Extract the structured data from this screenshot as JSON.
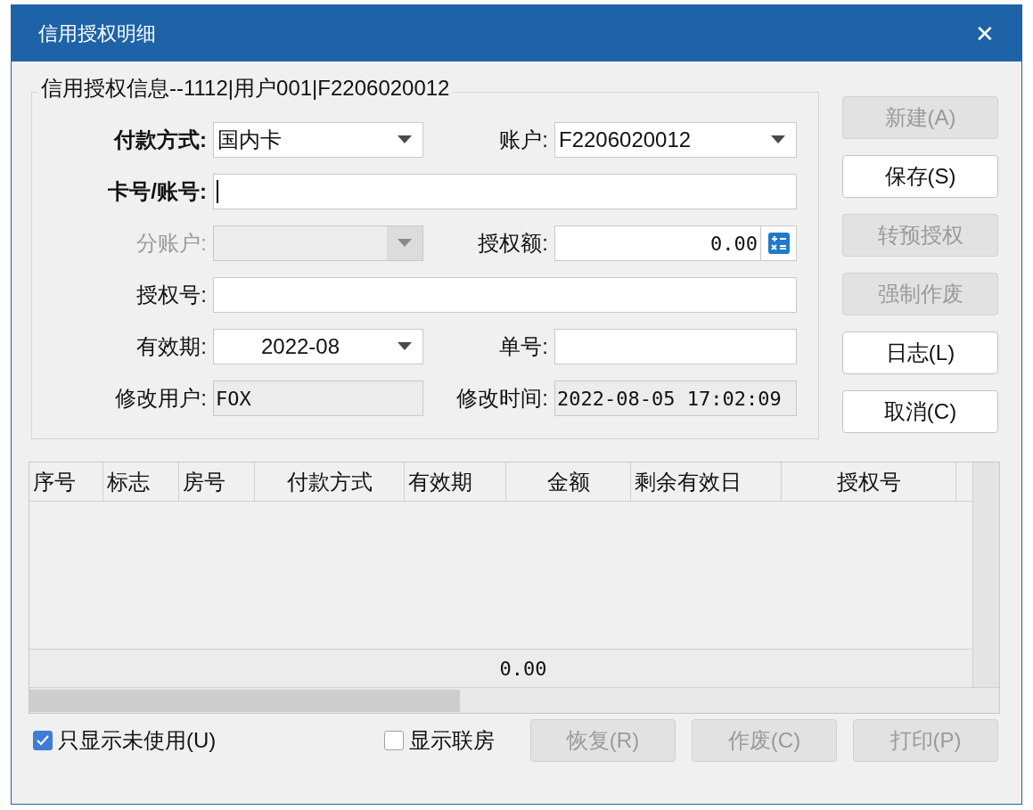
{
  "window": {
    "title": "信用授权明细",
    "close": "✕"
  },
  "group": {
    "title": "信用授权信息--1112|用户001|F2206020012"
  },
  "form_rows": [
    {
      "fields": [
        {
          "kind": "select",
          "label": "付款方式:",
          "bold": true,
          "value": "国内卡",
          "disabled": false
        },
        {
          "kind": "select",
          "label": "账户:",
          "bold": false,
          "value": "F2206020012",
          "disabled": false
        }
      ]
    },
    {
      "fields": [
        {
          "kind": "text",
          "label": "卡号/账号:",
          "bold": true,
          "focused": true
        }
      ]
    },
    {
      "fields": [
        {
          "kind": "select",
          "label": "分账户:",
          "bold": false,
          "disabled": true
        },
        {
          "kind": "number",
          "label": "授权额:",
          "bold": false,
          "value": "0.00"
        }
      ]
    },
    {
      "fields": [
        {
          "kind": "text",
          "label": "授权号:",
          "bold": false,
          "focused": false
        }
      ]
    },
    {
      "fields": [
        {
          "kind": "select",
          "label": "有效期:",
          "bold": false,
          "value": "2022-08",
          "centered": true,
          "disabled": false
        },
        {
          "kind": "text",
          "label": "单号:",
          "bold": false,
          "focused": false
        }
      ]
    },
    {
      "fields": [
        {
          "kind": "readonly",
          "label": "修改用户:",
          "bold": false,
          "value": "FOX"
        },
        {
          "kind": "readonly",
          "label": "修改时间:",
          "bold": false,
          "value": "2022-08-05 17:02:09"
        }
      ]
    }
  ],
  "side_buttons": [
    {
      "label": "新建(A)",
      "disabled": true
    },
    {
      "label": "保存(S)",
      "disabled": false
    },
    {
      "label": "转预授权",
      "disabled": true
    },
    {
      "label": "强制作废",
      "disabled": true
    },
    {
      "label": "日志(L)",
      "disabled": false
    },
    {
      "label": "取消(C)",
      "disabled": false
    }
  ],
  "table": {
    "columns": [
      "序号",
      "标志",
      "房号",
      "付款方式",
      "有效期",
      "金额",
      "剩余有效日",
      "授权号"
    ],
    "total": "0.00"
  },
  "options": [
    {
      "label": "只显示未使用(U)",
      "checked": true
    },
    {
      "label": "显示联房",
      "checked": false
    }
  ],
  "bottom_buttons": [
    {
      "label": "恢复(R)",
      "disabled": true
    },
    {
      "label": "作废(C)",
      "disabled": true
    },
    {
      "label": "打印(P)",
      "disabled": true
    }
  ]
}
